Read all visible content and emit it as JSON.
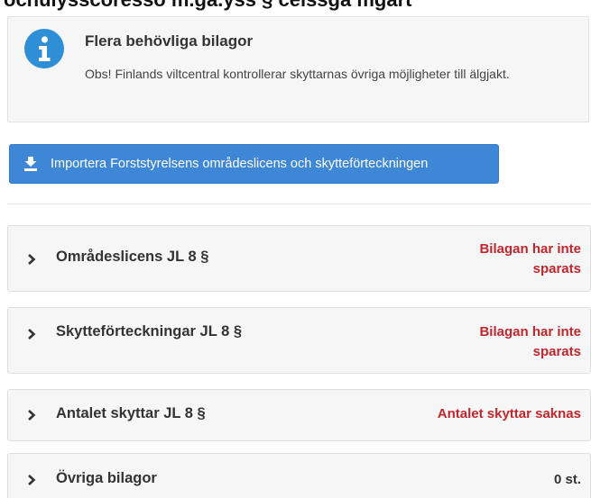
{
  "page": {
    "cropped_heading": "ocnulysscoresso m.ga.yss § celssga mgart"
  },
  "info": {
    "icon": "info-icon",
    "title": "Flera behövliga bilagor",
    "text": "Obs! Finlands viltcentral kontrollerar skyttarnas övriga möjligheter till älgjakt."
  },
  "import_button": {
    "icon": "import-icon",
    "label": "Importera Forststyrelsens områdeslicens och skytteförteckningen"
  },
  "attachments": [
    {
      "title": "Områdeslicens JL 8 §",
      "status": "Bilagan har inte sparats",
      "status_type": "error"
    },
    {
      "title": "Skytteförteckningar JL 8 §",
      "status": "Bilagan har inte sparats",
      "status_type": "error"
    },
    {
      "title": "Antalet skyttar JL 8 §",
      "status": "Antalet skyttar saknas",
      "status_type": "error"
    },
    {
      "title": "Övriga bilagor",
      "status": "0 st.",
      "status_type": "neutral"
    }
  ],
  "colors": {
    "accent_blue": "#3e86d6",
    "info_blue": "#2f8fd6",
    "error_red": "#c0262d",
    "panel_bg": "#f6f6f6"
  }
}
